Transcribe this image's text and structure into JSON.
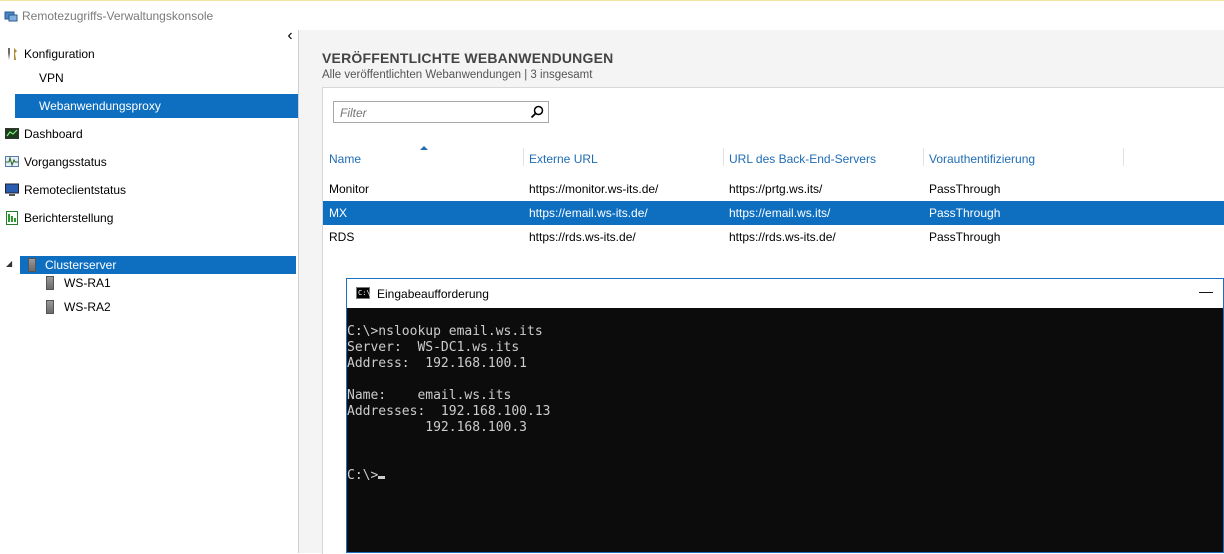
{
  "window": {
    "title": "Remotezugriffs-Verwaltungskonsole"
  },
  "sidebar": {
    "items": [
      {
        "label": "Konfiguration",
        "icon": "tools-icon"
      },
      {
        "label": "VPN"
      },
      {
        "label": "Webanwendungsproxy",
        "selected": true
      },
      {
        "label": "Dashboard",
        "icon": "dashboard-icon"
      },
      {
        "label": "Vorgangsstatus",
        "icon": "operations-status-icon"
      },
      {
        "label": "Remoteclientstatus",
        "icon": "monitor-icon"
      },
      {
        "label": "Berichterstellung",
        "icon": "report-icon"
      }
    ],
    "tree": {
      "root": "Clusterserver",
      "children": [
        "WS-RA1",
        "WS-RA2"
      ]
    }
  },
  "main": {
    "title": "VERÖFFENTLICHTE WEBANWENDUNGEN",
    "subtitle": "Alle veröffentlichten Webanwendungen | 3 insgesamt",
    "filter_placeholder": "Filter",
    "columns": [
      "Name",
      "Externe URL",
      "URL des Back-End-Servers",
      "Vorauthentifizierung"
    ],
    "rows": [
      [
        "Monitor",
        "https://monitor.ws-its.de/",
        "https://prtg.ws.its/",
        "PassThrough"
      ],
      [
        "MX",
        "https://email.ws-its.de/",
        "https://email.ws.its/",
        "PassThrough"
      ],
      [
        "RDS",
        "https://rds.ws-its.de/",
        "https://rds.ws-its.de/",
        "PassThrough"
      ]
    ],
    "selected_row": 1
  },
  "cmd": {
    "title": "Eingabeaufforderung",
    "minimize": "—",
    "lines": [
      "C:\\>nslookup email.ws.its",
      "Server:  WS-DC1.ws.its",
      "Address:  192.168.100.1",
      "",
      "Name:    email.ws.its",
      "Addresses:  192.168.100.13",
      "          192.168.100.3",
      "",
      "",
      "C:\\>"
    ]
  },
  "colors": {
    "accent": "#0e6fc1",
    "header_text": "#1f6cb5",
    "console_bg": "#0c0c0c"
  }
}
